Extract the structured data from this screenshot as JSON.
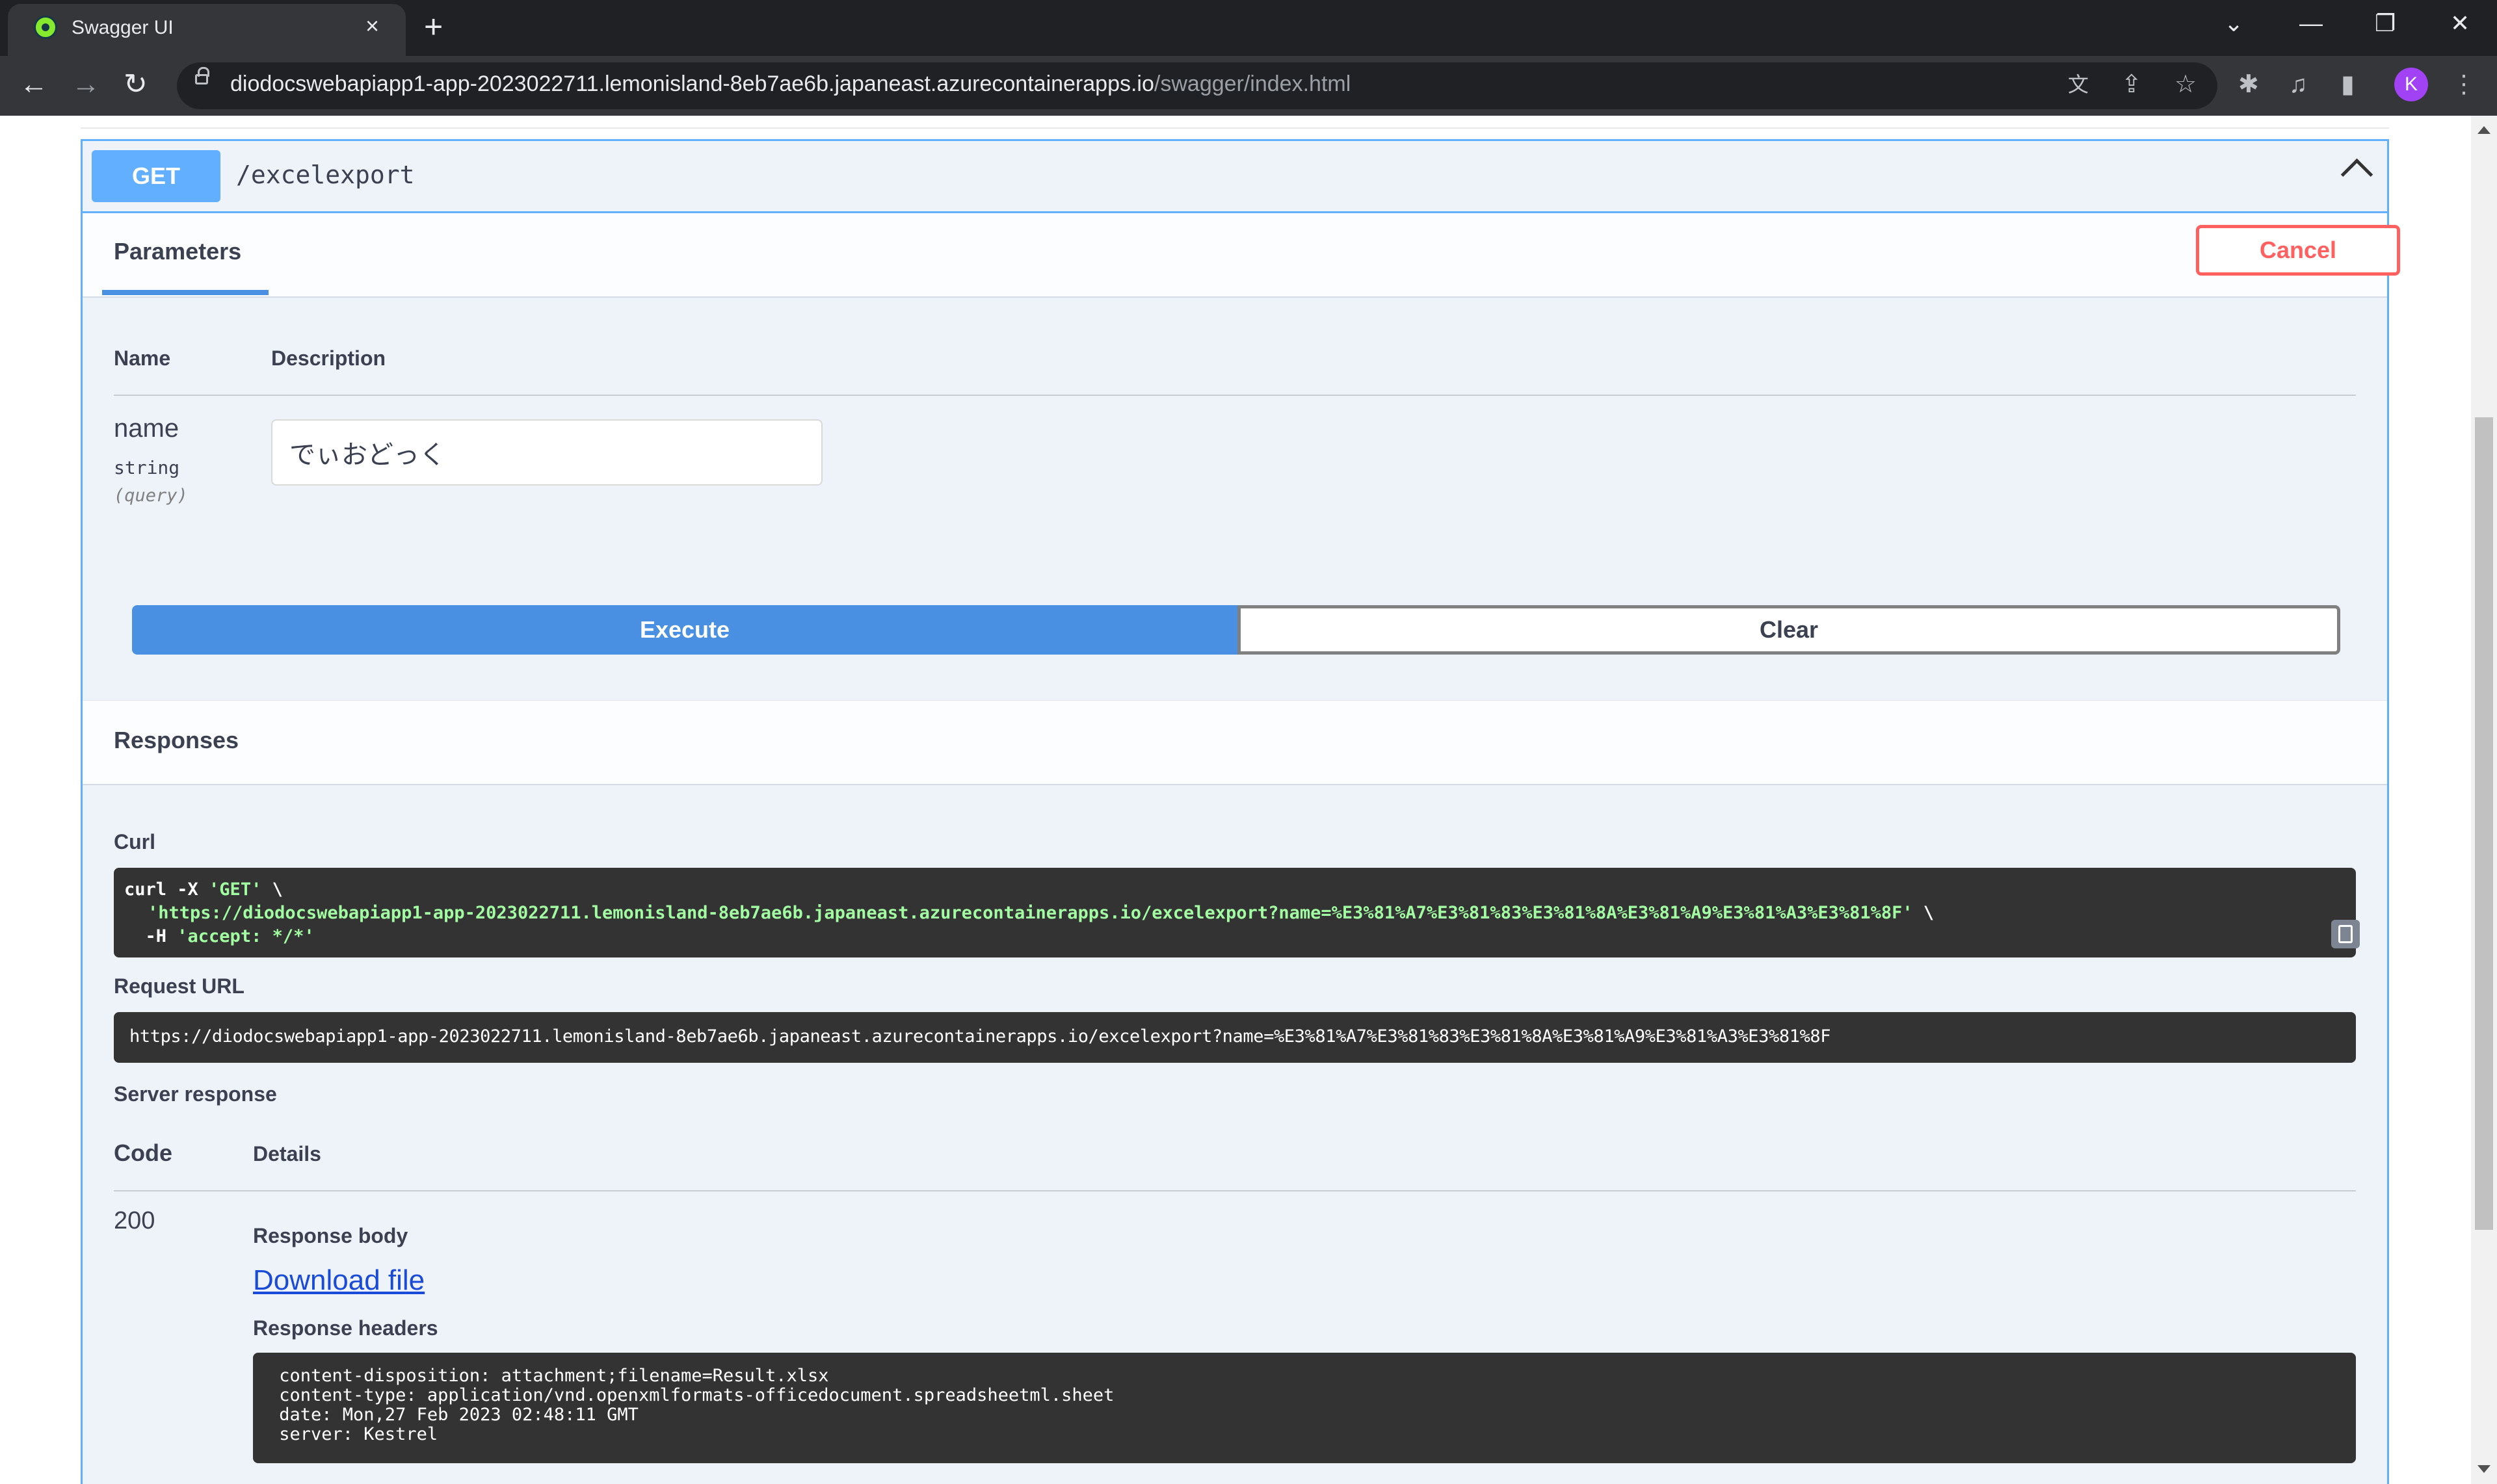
{
  "browser": {
    "tab_title": "Swagger UI",
    "tab_close_icon": "×",
    "new_tab_icon": "+",
    "url_host": "diodocswebapiapp1-app-2023022711.lemonisland-8eb7ae6b.japaneast.azurecontainerapps.io",
    "url_path": "/swagger/index.html",
    "avatar_letter": "K",
    "icons": [
      "tab-search-icon",
      "minimize-icon",
      "restore-icon",
      "close-window-icon",
      "back-icon",
      "forward-icon",
      "reload-icon",
      "lock-icon",
      "translate-icon",
      "share-icon",
      "star-icon",
      "extensions-icon",
      "media-icon",
      "side-panel-icon",
      "menu-icon"
    ]
  },
  "operation": {
    "method": "GET",
    "path": "/excelexport",
    "method_color": "#61affe"
  },
  "parameters": {
    "title": "Parameters",
    "cancel_label": "Cancel",
    "col_name": "Name",
    "col_description": "Description",
    "items": [
      {
        "name": "name",
        "type": "string",
        "in": "(query)",
        "value": "でぃおどっく"
      }
    ]
  },
  "actions": {
    "execute_label": "Execute",
    "clear_label": "Clear"
  },
  "responses": {
    "title": "Responses",
    "curl_label": "Curl",
    "curl_line1_cmd": "curl -X ",
    "curl_line1_method": "'GET'",
    "curl_line1_tail": " \\",
    "curl_line2_url": "'https://diodocswebapiapp1-app-2023022711.lemonisland-8eb7ae6b.japaneast.azurecontainerapps.io/excelexport?name=%E3%81%A7%E3%81%83%E3%81%8A%E3%81%A9%E3%81%A3%E3%81%8F'",
    "curl_line2_tail": " \\",
    "curl_line3_cmd": "  -H ",
    "curl_line3_header": "'accept: */*'",
    "request_url_label": "Request URL",
    "request_url": "https://diodocswebapiapp1-app-2023022711.lemonisland-8eb7ae6b.japaneast.azurecontainerapps.io/excelexport?name=%E3%81%A7%E3%81%83%E3%81%8A%E3%81%A9%E3%81%A3%E3%81%8F",
    "server_response_label": "Server response",
    "col_code": "Code",
    "col_details": "Details",
    "status_code": "200",
    "response_body_label": "Response body",
    "download_link": "Download file",
    "response_headers_label": "Response headers",
    "headers": [
      " content-disposition: attachment;filename=Result.xlsx",
      " content-type: application/vnd.openxmlformats-officedocument.spreadsheetml.sheet",
      " date: Mon,27 Feb 2023 02:48:11 GMT",
      " server: Kestrel"
    ]
  }
}
